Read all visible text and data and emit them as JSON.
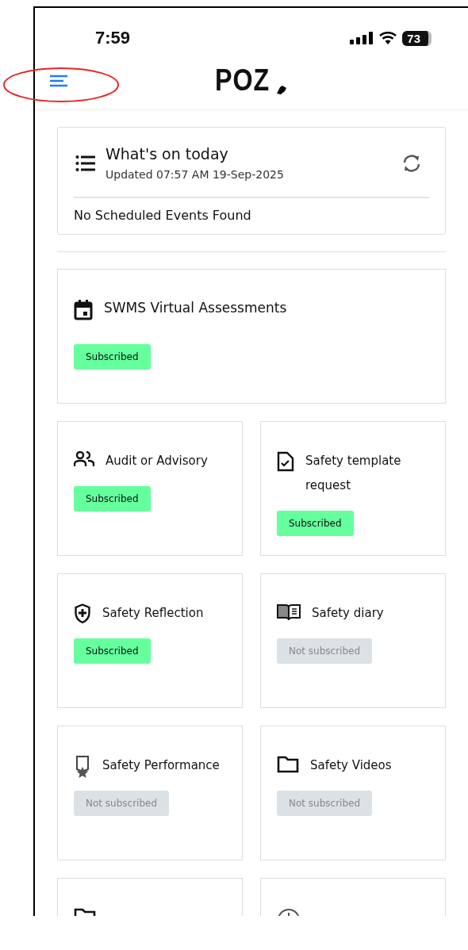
{
  "status_bar": {
    "time": "7:59",
    "battery": "73"
  },
  "header": {
    "logo": "POZ"
  },
  "today": {
    "title": "What's on today",
    "updated": "Updated 07:57 AM 19-Sep-2025",
    "message": "No Scheduled Events Found"
  },
  "modules": [
    {
      "kind": "calendar",
      "title": "SWMS Virtual Assessments",
      "status": "Subscribed",
      "subscribed": true,
      "wide": true
    },
    {
      "kind": "people",
      "title": "Audit or Advisory",
      "status": "Subscribed",
      "subscribed": true,
      "wide": false
    },
    {
      "kind": "document",
      "title": "Safety template request",
      "status": "Subscribed",
      "subscribed": true,
      "wide": false
    },
    {
      "kind": "shield",
      "title": "Safety Reflection",
      "status": "Subscribed",
      "subscribed": true,
      "wide": false
    },
    {
      "kind": "book",
      "title": "Safety diary",
      "status": "Not subscribed",
      "subscribed": false,
      "wide": false
    },
    {
      "kind": "award",
      "title": "Safety Performance",
      "status": "Not subscribed",
      "subscribed": false,
      "wide": false
    },
    {
      "kind": "folder",
      "title": "Safety Videos",
      "status": "Not subscribed",
      "subscribed": false,
      "wide": false
    },
    {
      "kind": "folder",
      "wide": false
    },
    {
      "kind": "clock",
      "wide": false
    }
  ]
}
